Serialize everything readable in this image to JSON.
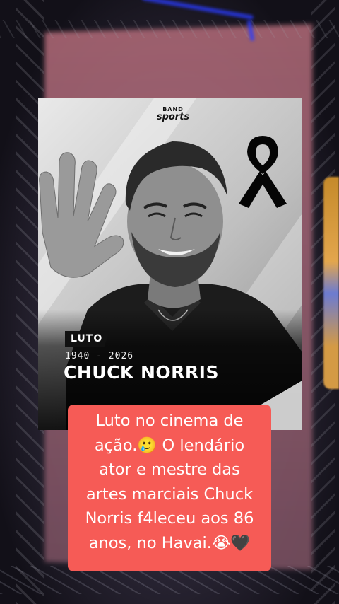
{
  "poster": {
    "brand_top": "BAND",
    "brand_bottom": "sports",
    "tag": "LUTO",
    "years": "1940 - 2026",
    "name": "CHUCK NORRIS",
    "ribbon_icon": "black-mourning-ribbon-icon"
  },
  "caption": {
    "lines": [
      "Luto no cinema de",
      "ação.🥲 O lendário",
      "ator e mestre das",
      "artes marciais Chuck",
      "Norris f4leceu aos 86",
      "anos, no Havai.😭🖤"
    ]
  },
  "colors": {
    "caption_bg": "#f65b56",
    "caption_text": "#ffffff",
    "tag_bg": "#111111"
  }
}
